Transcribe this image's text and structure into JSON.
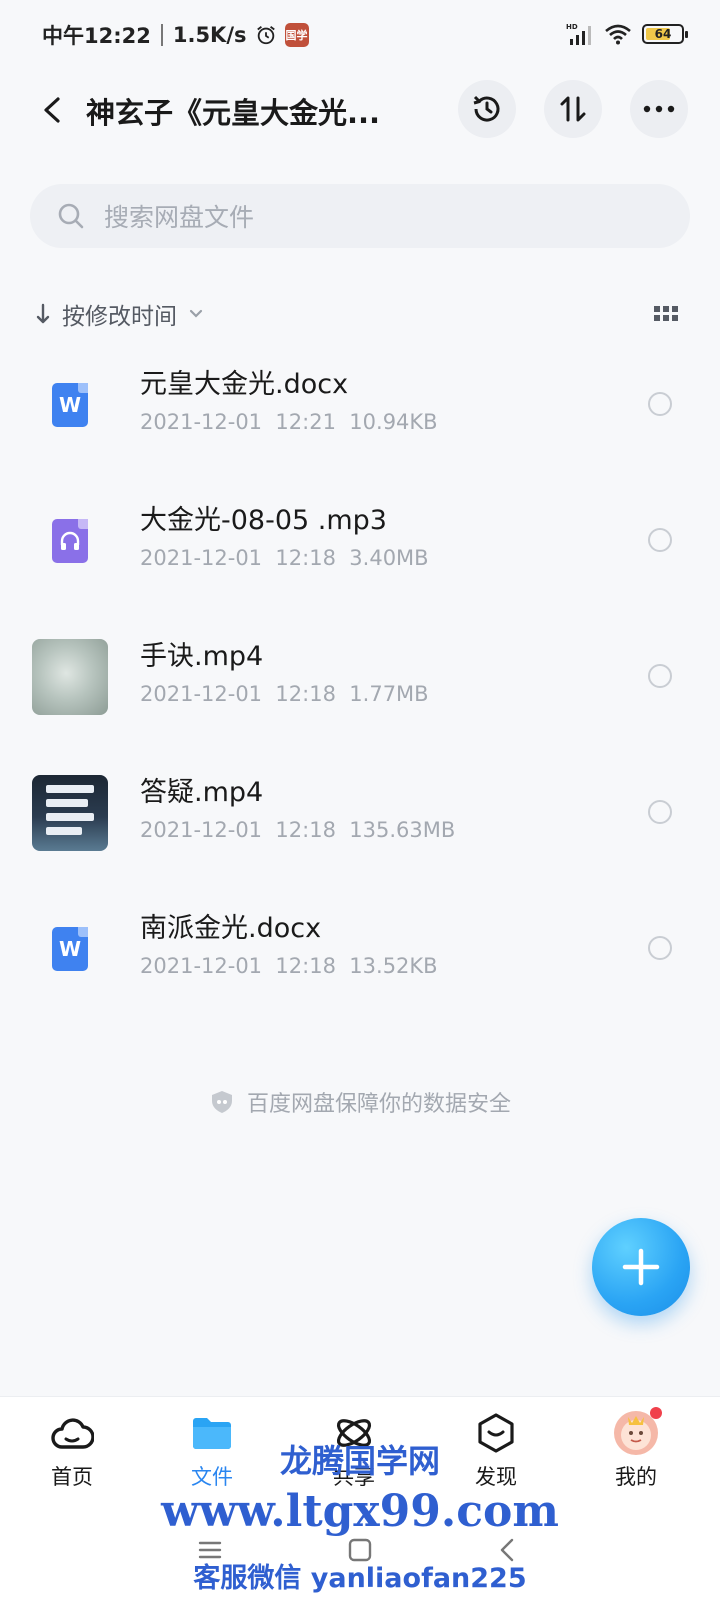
{
  "status_bar": {
    "time": "中午12:22",
    "speed": "1.5K/s",
    "battery_level": "64",
    "app_icon_text": "国学"
  },
  "header": {
    "title": "神玄子《元皇大金光..."
  },
  "search": {
    "placeholder": "搜索网盘文件"
  },
  "sort": {
    "label": "按修改时间"
  },
  "files": [
    {
      "name": "元皇大金光.docx",
      "date": "2021-12-01",
      "time": "12:21",
      "size": "10.94KB",
      "type": "doc",
      "icon": "W"
    },
    {
      "name": "大金光-08-05 .mp3",
      "date": "2021-12-01",
      "time": "12:18",
      "size": "3.40MB",
      "type": "audio"
    },
    {
      "name": "手诀.mp4",
      "date": "2021-12-01",
      "time": "12:18",
      "size": "1.77MB",
      "type": "video-1"
    },
    {
      "name": "答疑.mp4",
      "date": "2021-12-01",
      "time": "12:18",
      "size": "135.63MB",
      "type": "video-2"
    },
    {
      "name": "南派金光.docx",
      "date": "2021-12-01",
      "time": "12:18",
      "size": "13.52KB",
      "type": "doc",
      "icon": "W"
    }
  ],
  "safety_note": "百度网盘保障你的数据安全",
  "tabs": [
    {
      "label": "首页",
      "icon": "cloud-home-icon"
    },
    {
      "label": "文件",
      "icon": "folder-icon"
    },
    {
      "label": "共享",
      "icon": "share-icon"
    },
    {
      "label": "发现",
      "icon": "discover-icon"
    },
    {
      "label": "我的",
      "icon": "avatar"
    }
  ],
  "watermark": {
    "line1": "龙腾国学网",
    "line2": "www.ltgx99.com",
    "line3": "客服微信 yanliaofan225"
  },
  "colors": {
    "accent": "#2a86f0",
    "doc": "#3f82f0",
    "audio": "#8a70e8",
    "fab": "#2aa4f4",
    "watermark": "#2f5fd0"
  }
}
